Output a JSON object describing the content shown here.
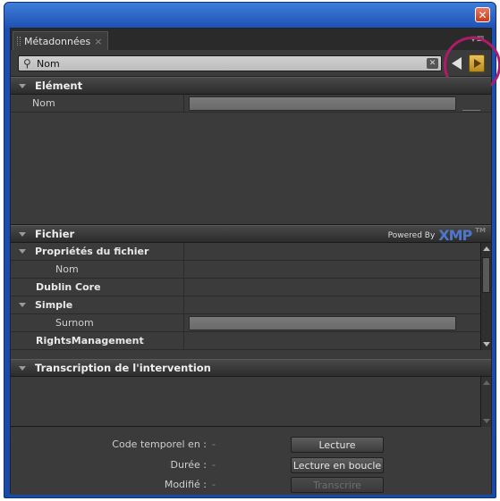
{
  "window": {
    "close_label": "✕"
  },
  "tab": {
    "title": "Métadonnées",
    "close": "×"
  },
  "panel_menu": "▾≡",
  "search": {
    "value": "Nom",
    "placeholder": ""
  },
  "element_section": {
    "title": "Elément",
    "rows": [
      {
        "label": "Nom",
        "value": ""
      }
    ]
  },
  "fichier_section": {
    "title": "Fichier",
    "powered_by": "Powered By",
    "xmp_logo": "XMP",
    "tm": "TM",
    "rows": [
      {
        "label": "Propriétés du fichier",
        "kind": "group"
      },
      {
        "label": "Nom",
        "kind": "item"
      },
      {
        "label": "Dublin Core",
        "kind": "schema"
      },
      {
        "label": "Simple",
        "kind": "group"
      },
      {
        "label": "Surnom",
        "kind": "field"
      },
      {
        "label": "RightsManagement",
        "kind": "schema"
      }
    ]
  },
  "transcription_section": {
    "title": "Transcription de l'intervention"
  },
  "footer": {
    "timecode_label": "Code temporel en :",
    "timecode_value": "-",
    "duration_label": "Durée :",
    "duration_value": "-",
    "modified_label": "Modifié :",
    "modified_value": "-",
    "play_button": "Lecture",
    "loop_button": "Lecture en boucle",
    "transcribe_button": "Transcrire"
  },
  "colors": {
    "window_blue": "#1c4fb3",
    "panel_bg": "#3b3b3b",
    "accent_orange": "#e9c05a",
    "highlight": "#b01a6a",
    "xmp_blue": "#4e76c9"
  }
}
